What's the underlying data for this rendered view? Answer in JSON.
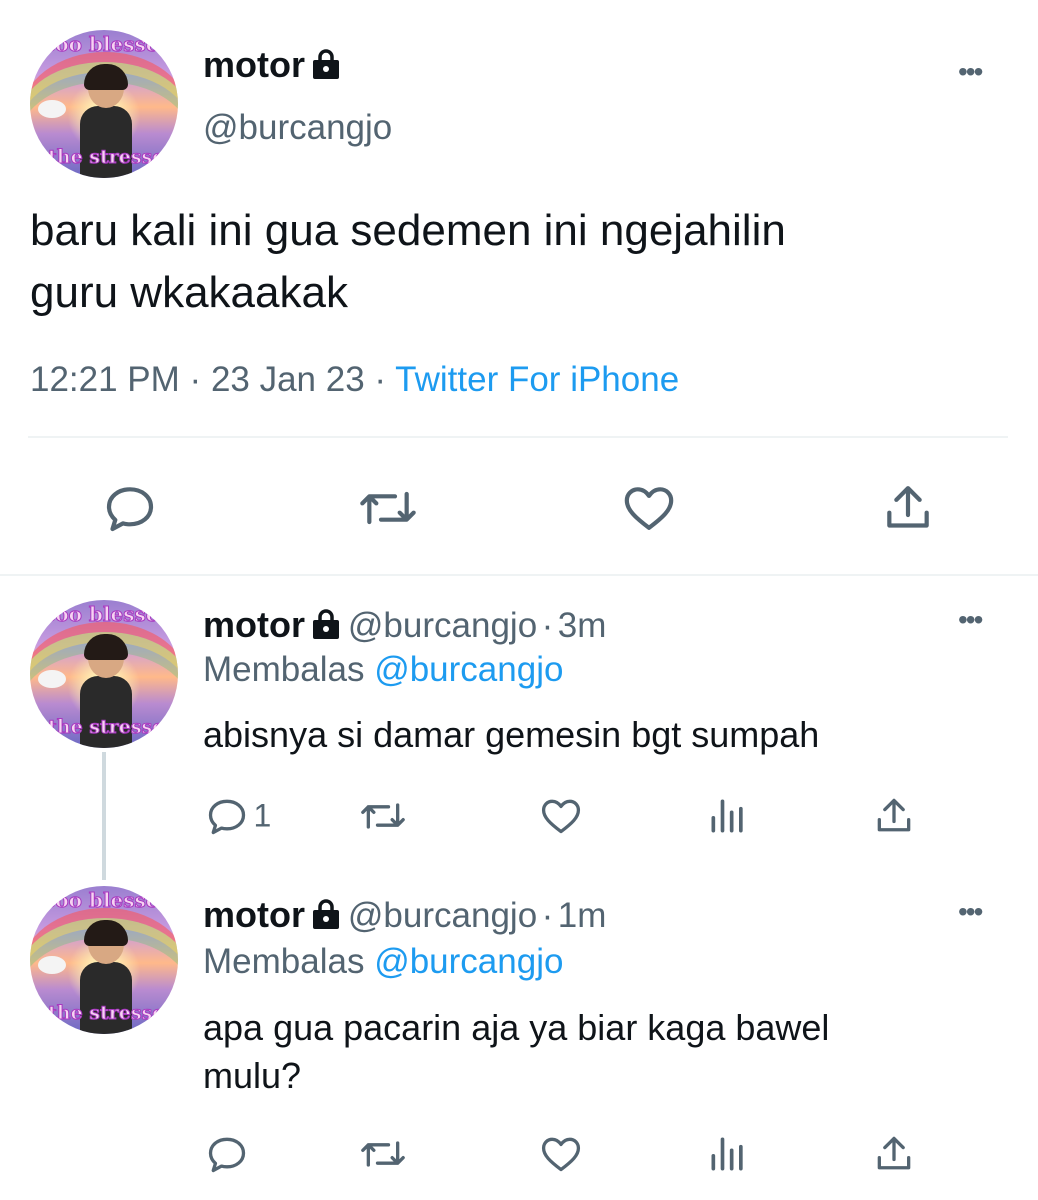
{
  "main_tweet": {
    "display_name": "motor",
    "handle": "@burcangjo",
    "text_line1": "baru kali ini gua sedemen ini ngejahilin",
    "text_line2": "guru wkakaakak",
    "time": "12:21 PM",
    "sep1": "·",
    "date": "23 Jan 23",
    "sep2": "·",
    "source": "Twitter For iPhone",
    "avatar_text_top": "soo blessed",
    "avatar_text_bottom": "the stressed"
  },
  "replies": [
    {
      "display_name": "motor",
      "handle": "@burcangjo",
      "dot": "·",
      "age": "3m",
      "replying_label": "Membalas",
      "replying_to": "@burcangjo",
      "text": "abisnya si damar gemesin bgt sumpah",
      "text2": "",
      "reply_count": "1"
    },
    {
      "display_name": "motor",
      "handle": "@burcangjo",
      "dot": "·",
      "age": "1m",
      "replying_label": "Membalas",
      "replying_to": "@burcangjo",
      "text": "apa gua pacarin aja ya biar kaga bawel",
      "text2": "mulu?",
      "reply_count": ""
    }
  ],
  "more_label": "•••",
  "icons": [
    "lock-icon",
    "more-icon",
    "reply-icon",
    "retweet-icon",
    "like-icon",
    "share-icon",
    "views-icon"
  ],
  "colors": {
    "accent": "#1d9bf0",
    "secondary_text": "#536471",
    "primary_text": "#0f1419"
  }
}
